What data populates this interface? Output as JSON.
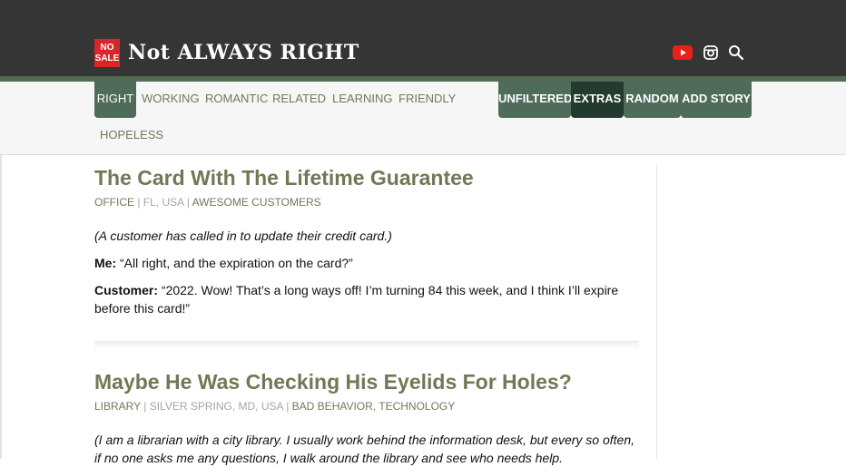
{
  "header": {
    "logo_badge_line1": "NO",
    "logo_badge_line2": "SALE",
    "logo_text": "Not ALWAYS RIGHT",
    "brand_red": "#d8262a",
    "header_bg": "#353535",
    "social_icons": [
      "youtube-icon",
      "instagram-icon",
      "search-icon"
    ]
  },
  "nav": {
    "items": [
      {
        "label": "RIGHT",
        "active": true
      },
      {
        "label": "WORKING"
      },
      {
        "label": "ROMANTIC"
      },
      {
        "label": "RELATED"
      },
      {
        "label": "LEARNING"
      },
      {
        "label": "FRIENDLY"
      },
      {
        "label": "HOPELESS"
      }
    ],
    "tabs": [
      {
        "label": "UNFILTERED"
      },
      {
        "label": "EXTRAS"
      },
      {
        "label": "RANDOM"
      },
      {
        "label": "ADD STORY"
      }
    ],
    "accent": "#4f6b5a",
    "accent_dark": "#233b2e",
    "link_color": "#6f7a55"
  },
  "stories": [
    {
      "title": "The Card With The Lifetime Guarantee",
      "category": "OFFICE",
      "location": "FL, USA",
      "tags": "AWESOME CUSTOMERS",
      "paragraphs": [
        {
          "speaker": "",
          "text": "(A customer has called in to update their credit card.)",
          "italic": true
        },
        {
          "speaker": "Me:",
          "text": " “All right, and the expiration on the card?”"
        },
        {
          "speaker": "Customer:",
          "text": " “2022. Wow! That’s a long ways off! I’m turning 84 this week, and I think I’ll expire before this card!”"
        }
      ]
    },
    {
      "title": "Maybe He Was Checking His Eyelids For Holes?",
      "category": "LIBRARY",
      "location": "SILVER SPRING, MD, USA",
      "tags": "BAD BEHAVIOR, TECHNOLOGY",
      "paragraphs": [
        {
          "speaker": "",
          "text": "(I am a librarian with a city library. I usually work behind the information desk, but every so often, if no one asks me any questions, I walk around the library and see who needs help.",
          "italic": true
        }
      ]
    }
  ]
}
